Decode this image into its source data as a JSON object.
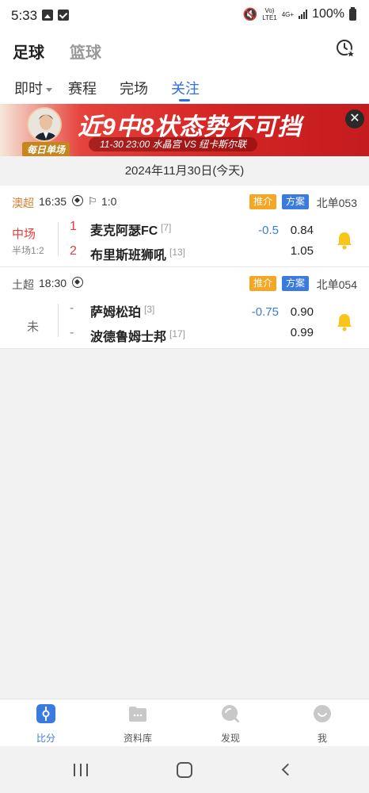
{
  "status_bar": {
    "time": "5:33",
    "network_top": "Vo)",
    "network_bottom": "LTE1",
    "network_gen": "4G+",
    "battery": "100%"
  },
  "top_nav": {
    "sport_tabs": [
      {
        "label": "足球",
        "active": true
      },
      {
        "label": "篮球",
        "active": false
      }
    ],
    "history_icon": "clock-star-icon"
  },
  "sub_tabs": [
    {
      "label": "即时",
      "has_dropdown": true,
      "active": false
    },
    {
      "label": "赛程",
      "active": false
    },
    {
      "label": "完场",
      "active": false
    },
    {
      "label": "关注",
      "active": true
    }
  ],
  "banner": {
    "tag": "每日单场",
    "headline": "近9中8状态势不可挡",
    "match_line": "11-30 23:00  水晶宫 VS 纽卡斯尔联",
    "close": "✕"
  },
  "date_header": "2024年11月30日(今天)",
  "matches": [
    {
      "league": "澳超",
      "time": "16:35",
      "corner": "1:0",
      "badge_recommend": "推介",
      "badge_plan": "方案",
      "code": "北单053",
      "status": "中场",
      "half_score": "半场1:2",
      "home": {
        "score": "1",
        "name": "麦克阿瑟FC",
        "rank": "[7]",
        "odds": "0.84"
      },
      "away": {
        "score": "2",
        "name": "布里斯班狮吼",
        "rank": "[13]",
        "odds": "1.05"
      },
      "handicap": "-0.5"
    },
    {
      "league": "土超",
      "time": "18:30",
      "badge_recommend": "推介",
      "badge_plan": "方案",
      "code": "北单054",
      "status": "未",
      "home": {
        "score": "-",
        "name": "萨姆松珀",
        "rank": "[3]",
        "odds": "0.90"
      },
      "away": {
        "score": "-",
        "name": "波德鲁姆士邦",
        "rank": "[17]",
        "odds": "0.99"
      },
      "handicap": "-0.75"
    }
  ],
  "bottom_nav": [
    {
      "label": "比分",
      "icon": "scoreboard-icon",
      "active": true
    },
    {
      "label": "资料库",
      "icon": "folder-icon",
      "active": false
    },
    {
      "label": "发现",
      "icon": "discover-icon",
      "active": false
    },
    {
      "label": "我",
      "icon": "profile-icon",
      "active": false
    }
  ],
  "colors": {
    "accent": "#3b7be0",
    "live_red": "#e33d3d",
    "bell": "#f7c51c",
    "badge_orange": "#f5a623"
  }
}
